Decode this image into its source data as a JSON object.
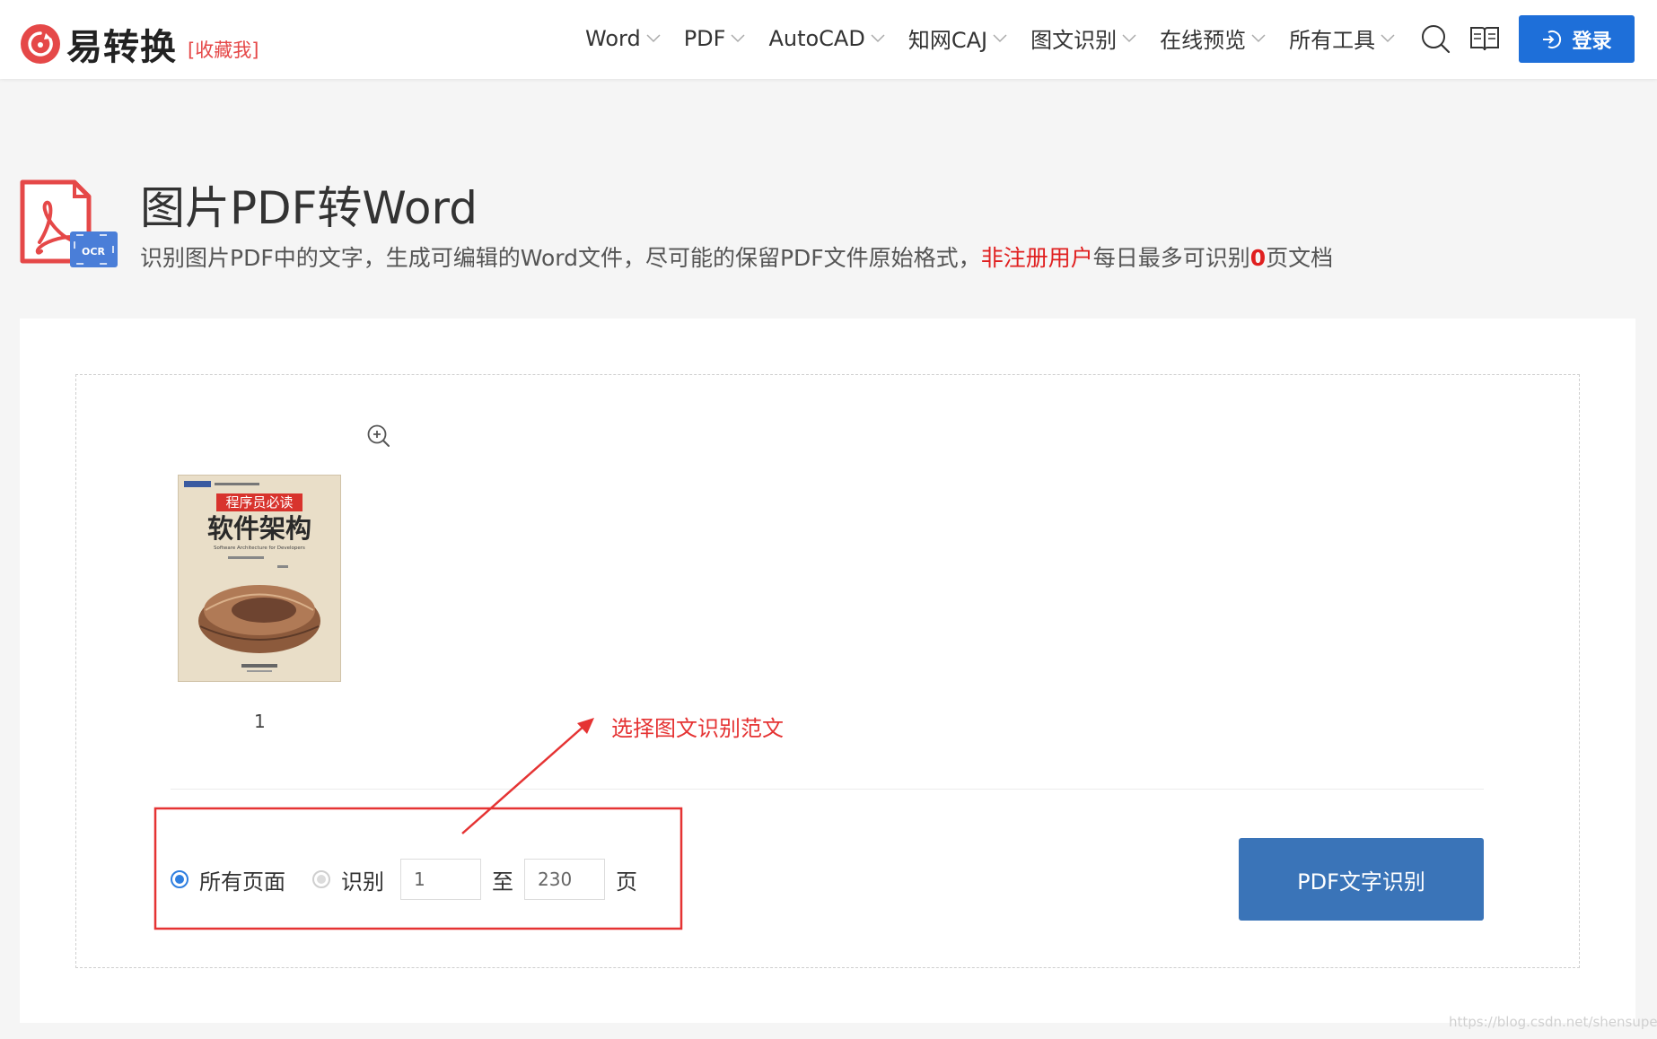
{
  "header": {
    "logo_text": "易转换",
    "favorite_label": "[收藏我]",
    "nav": [
      {
        "label": "Word"
      },
      {
        "label": "PDF"
      },
      {
        "label": "AutoCAD"
      },
      {
        "label": "知网CAJ"
      },
      {
        "label": "图文识别"
      },
      {
        "label": "在线预览"
      },
      {
        "label": "所有工具"
      }
    ],
    "login_label": "登录"
  },
  "hero": {
    "title": "图片PDF转Word",
    "desc_prefix": "识别图片PDF中的文字，生成可编辑的Word文件，尽可能的保留PDF文件原始格式，",
    "desc_highlight": "非注册用户",
    "desc_middle": "每日最多可识别",
    "desc_count": "0",
    "desc_suffix": "页文档",
    "icon_badge": "OCR"
  },
  "preview": {
    "page_number": "1",
    "thumbnail": {
      "subtitle": "程序员必读",
      "title": "软件架构",
      "english": "Software Architecture for Developers"
    }
  },
  "annotation": {
    "text": "选择图文识别范文"
  },
  "range": {
    "all_pages_label": "所有页面",
    "recognize_label": "识别",
    "from_value": "1",
    "to_label": "至",
    "to_value": "230",
    "unit_label": "页",
    "selected": "all"
  },
  "convert_button_label": "PDF文字识别",
  "watermark": "https://blog.csdn.net/shensuper",
  "colors": {
    "brand_red": "#e54848",
    "login_blue": "#1e6fd9",
    "convert_blue": "#3a74b8",
    "annotation_red": "#e53333",
    "radio_blue": "#2f7fe0"
  }
}
